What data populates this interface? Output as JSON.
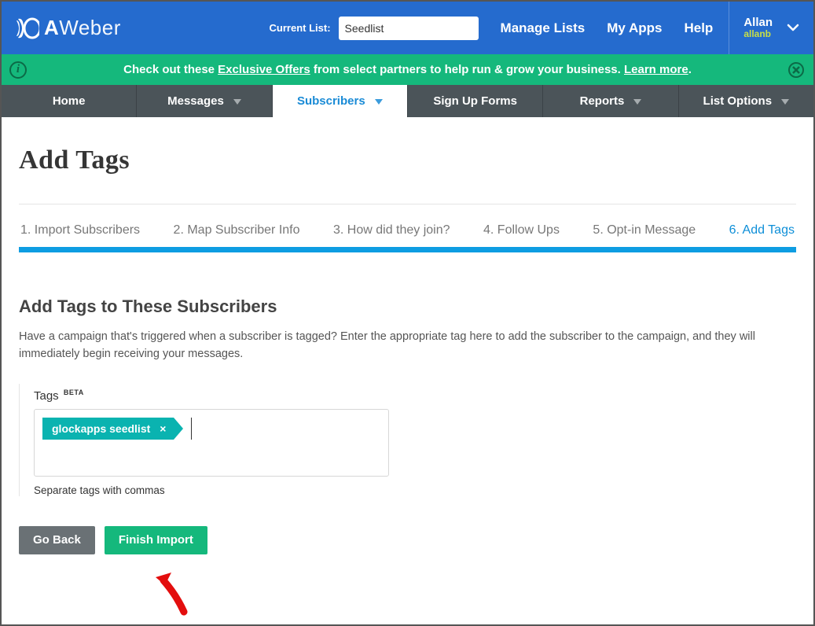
{
  "header": {
    "brand": "AWeber",
    "current_list_label": "Current List:",
    "list_value": "Seedlist",
    "nav": {
      "manage_lists": "Manage Lists",
      "my_apps": "My Apps",
      "help": "Help"
    },
    "user": {
      "name": "Allan",
      "handle": "allanb"
    }
  },
  "promo": {
    "prefix": "Check out these ",
    "link1": "Exclusive Offers",
    "middle": " from select partners to help run & grow your business. ",
    "link2": "Learn more",
    "period": "."
  },
  "mainnav": {
    "home": "Home",
    "messages": "Messages",
    "subscribers": "Subscribers",
    "sign_up_forms": "Sign Up Forms",
    "reports": "Reports",
    "list_options": "List Options"
  },
  "page": {
    "title": "Add Tags",
    "steps": [
      "1. Import Subscribers",
      "2. Map Subscriber Info",
      "3. How did they join?",
      "4. Follow Ups",
      "5. Opt-in Message",
      "6. Add Tags"
    ],
    "section_title": "Add Tags to These Subscribers",
    "section_desc": "Have a campaign that's triggered when a subscriber is tagged? Enter the appropriate tag here to add the subscriber to the campaign, and they will immediately begin receiving your messages.",
    "tags_label": "Tags ",
    "tags_badge": "BETA",
    "tag_value": "glockapps seedlist",
    "tags_hint": "Separate tags with commas",
    "go_back": "Go Back",
    "finish": "Finish Import"
  }
}
